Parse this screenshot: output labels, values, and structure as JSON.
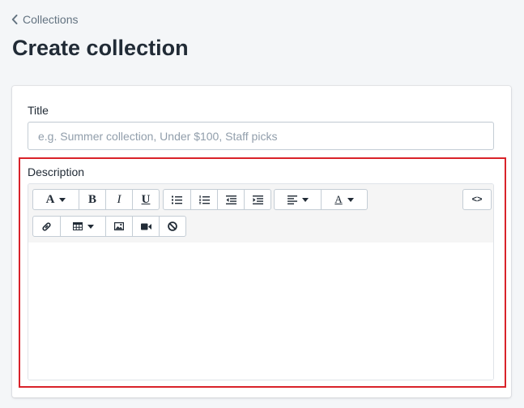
{
  "breadcrumb": {
    "label": "Collections"
  },
  "page": {
    "title": "Create collection"
  },
  "title_field": {
    "label": "Title",
    "value": "",
    "placeholder": "e.g. Summer collection, Under $100, Staff picks"
  },
  "description_field": {
    "label": "Description",
    "content": ""
  },
  "toolbar": {
    "font_glyph": "A",
    "bold_glyph": "B",
    "italic_glyph": "I",
    "underline_glyph": "U",
    "text_color_glyph": "A",
    "html_glyph": "<>",
    "buttons": [
      "font-style",
      "bold",
      "italic",
      "underline",
      "bullet-list",
      "numbered-list",
      "outdent",
      "indent",
      "align",
      "text-color",
      "show-html",
      "link",
      "table",
      "image",
      "video",
      "clear-formatting"
    ]
  },
  "colors": {
    "background": "#f4f6f8",
    "highlight": "#d9232a",
    "text": "#212b36",
    "muted": "#637381"
  }
}
